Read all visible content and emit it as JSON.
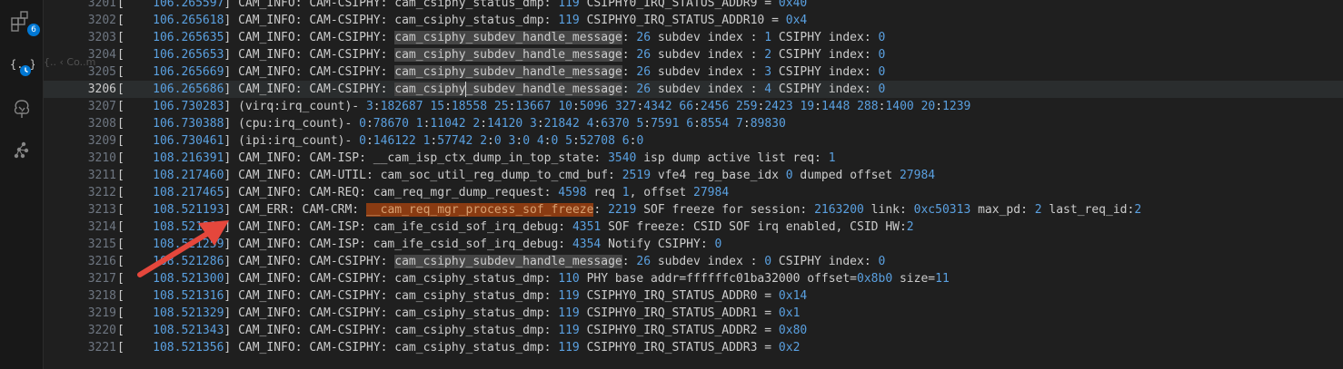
{
  "activity_bar": {
    "extensions_badge": "6"
  },
  "ghost_hint": "{.. ‹ Co..m",
  "colors": {
    "editor_bg": "#1f1f1f",
    "line_number": "#6e7681",
    "number": "#5aa0e0",
    "selection_highlight": "#454545",
    "error_highlight": "#8a3b12",
    "arrow": "#e5473c"
  },
  "editor": {
    "cursor_line": "3206",
    "lines": [
      {
        "n": "3201",
        "parts": [
          [
            "[    ",
            ""
          ],
          [
            "106.265597",
            "ts"
          ],
          [
            "] CAM_INFO: CAM-CSIPHY: cam_csiphy_status_dmp: ",
            ""
          ],
          [
            "119",
            "num"
          ],
          [
            " CSIPHY0_IRQ_STATUS_ADDR9 = ",
            ""
          ],
          [
            "0x40",
            "num"
          ]
        ]
      },
      {
        "n": "3202",
        "parts": [
          [
            "[    ",
            ""
          ],
          [
            "106.265618",
            "ts"
          ],
          [
            "] CAM_INFO: CAM-CSIPHY: cam_csiphy_status_dmp: ",
            ""
          ],
          [
            "119",
            "num"
          ],
          [
            " CSIPHY0_IRQ_STATUS_ADDR10 = ",
            ""
          ],
          [
            "0x4",
            "num"
          ]
        ]
      },
      {
        "n": "3203",
        "parts": [
          [
            "[    ",
            ""
          ],
          [
            "106.265635",
            "ts"
          ],
          [
            "] CAM_INFO: CAM-CSIPHY: ",
            ""
          ],
          [
            "cam_csiphy_subdev_handle_message",
            "hl"
          ],
          [
            ": ",
            ""
          ],
          [
            "26",
            "num"
          ],
          [
            " subdev index : ",
            ""
          ],
          [
            "1",
            "num"
          ],
          [
            " CSIPHY index: ",
            ""
          ],
          [
            "0",
            "num"
          ]
        ]
      },
      {
        "n": "3204",
        "parts": [
          [
            "[    ",
            ""
          ],
          [
            "106.265653",
            "ts"
          ],
          [
            "] CAM_INFO: CAM-CSIPHY: ",
            ""
          ],
          [
            "cam_csiphy_subdev_handle_message",
            "hl"
          ],
          [
            ": ",
            ""
          ],
          [
            "26",
            "num"
          ],
          [
            " subdev index : ",
            ""
          ],
          [
            "2",
            "num"
          ],
          [
            " CSIPHY index: ",
            ""
          ],
          [
            "0",
            "num"
          ]
        ]
      },
      {
        "n": "3205",
        "parts": [
          [
            "[    ",
            ""
          ],
          [
            "106.265669",
            "ts"
          ],
          [
            "] CAM_INFO: CAM-CSIPHY: ",
            ""
          ],
          [
            "cam_csiphy_subdev_handle_message",
            "hl"
          ],
          [
            ": ",
            ""
          ],
          [
            "26",
            "num"
          ],
          [
            " subdev index : ",
            ""
          ],
          [
            "3",
            "num"
          ],
          [
            " CSIPHY index: ",
            ""
          ],
          [
            "0",
            "num"
          ]
        ]
      },
      {
        "n": "3206",
        "parts": [
          [
            "[    ",
            ""
          ],
          [
            "106.265686",
            "ts"
          ],
          [
            "] CAM_INFO: CAM-CSIPHY: ",
            ""
          ],
          [
            "cam_csiphy_subdev_handle_message",
            "hl"
          ],
          [
            ": ",
            ""
          ],
          [
            "26",
            "num"
          ],
          [
            " subdev index : ",
            ""
          ],
          [
            "4",
            "num"
          ],
          [
            " CSIPHY index: ",
            ""
          ],
          [
            "0",
            "num"
          ]
        ]
      },
      {
        "n": "3207",
        "parts": [
          [
            "[    ",
            ""
          ],
          [
            "106.730283",
            "ts"
          ],
          [
            "] (virq:irq_count)- ",
            ""
          ],
          [
            "3",
            "num"
          ],
          [
            ":",
            ""
          ],
          [
            "182687",
            "num"
          ],
          [
            " ",
            ""
          ],
          [
            "15",
            "num"
          ],
          [
            ":",
            ""
          ],
          [
            "18558",
            "num"
          ],
          [
            " ",
            ""
          ],
          [
            "25",
            "num"
          ],
          [
            ":",
            ""
          ],
          [
            "13667",
            "num"
          ],
          [
            " ",
            ""
          ],
          [
            "10",
            "num"
          ],
          [
            ":",
            ""
          ],
          [
            "5096",
            "num"
          ],
          [
            " ",
            ""
          ],
          [
            "327",
            "num"
          ],
          [
            ":",
            ""
          ],
          [
            "4342",
            "num"
          ],
          [
            " ",
            ""
          ],
          [
            "66",
            "num"
          ],
          [
            ":",
            ""
          ],
          [
            "2456",
            "num"
          ],
          [
            " ",
            ""
          ],
          [
            "259",
            "num"
          ],
          [
            ":",
            ""
          ],
          [
            "2423",
            "num"
          ],
          [
            " ",
            ""
          ],
          [
            "19",
            "num"
          ],
          [
            ":",
            ""
          ],
          [
            "1448",
            "num"
          ],
          [
            " ",
            ""
          ],
          [
            "288",
            "num"
          ],
          [
            ":",
            ""
          ],
          [
            "1400",
            "num"
          ],
          [
            " ",
            ""
          ],
          [
            "20",
            "num"
          ],
          [
            ":",
            ""
          ],
          [
            "1239",
            "num"
          ]
        ]
      },
      {
        "n": "3208",
        "parts": [
          [
            "[    ",
            ""
          ],
          [
            "106.730388",
            "ts"
          ],
          [
            "] (cpu:irq_count)- ",
            ""
          ],
          [
            "0",
            "num"
          ],
          [
            ":",
            ""
          ],
          [
            "78670",
            "num"
          ],
          [
            " ",
            ""
          ],
          [
            "1",
            "num"
          ],
          [
            ":",
            ""
          ],
          [
            "11042",
            "num"
          ],
          [
            " ",
            ""
          ],
          [
            "2",
            "num"
          ],
          [
            ":",
            ""
          ],
          [
            "14120",
            "num"
          ],
          [
            " ",
            ""
          ],
          [
            "3",
            "num"
          ],
          [
            ":",
            ""
          ],
          [
            "21842",
            "num"
          ],
          [
            " ",
            ""
          ],
          [
            "4",
            "num"
          ],
          [
            ":",
            ""
          ],
          [
            "6370",
            "num"
          ],
          [
            " ",
            ""
          ],
          [
            "5",
            "num"
          ],
          [
            ":",
            ""
          ],
          [
            "7591",
            "num"
          ],
          [
            " ",
            ""
          ],
          [
            "6",
            "num"
          ],
          [
            ":",
            ""
          ],
          [
            "8554",
            "num"
          ],
          [
            " ",
            ""
          ],
          [
            "7",
            "num"
          ],
          [
            ":",
            ""
          ],
          [
            "89830",
            "num"
          ]
        ]
      },
      {
        "n": "3209",
        "parts": [
          [
            "[    ",
            ""
          ],
          [
            "106.730461",
            "ts"
          ],
          [
            "] (ipi:irq_count)- ",
            ""
          ],
          [
            "0",
            "num"
          ],
          [
            ":",
            ""
          ],
          [
            "146122",
            "num"
          ],
          [
            " ",
            ""
          ],
          [
            "1",
            "num"
          ],
          [
            ":",
            ""
          ],
          [
            "57742",
            "num"
          ],
          [
            " ",
            ""
          ],
          [
            "2",
            "num"
          ],
          [
            ":",
            ""
          ],
          [
            "0",
            "num"
          ],
          [
            " ",
            ""
          ],
          [
            "3",
            "num"
          ],
          [
            ":",
            ""
          ],
          [
            "0",
            "num"
          ],
          [
            " ",
            ""
          ],
          [
            "4",
            "num"
          ],
          [
            ":",
            ""
          ],
          [
            "0",
            "num"
          ],
          [
            " ",
            ""
          ],
          [
            "5",
            "num"
          ],
          [
            ":",
            ""
          ],
          [
            "52708",
            "num"
          ],
          [
            " ",
            ""
          ],
          [
            "6",
            "num"
          ],
          [
            ":",
            ""
          ],
          [
            "0",
            "num"
          ]
        ]
      },
      {
        "n": "3210",
        "parts": [
          [
            "[    ",
            ""
          ],
          [
            "108.216391",
            "ts"
          ],
          [
            "] CAM_INFO: CAM-ISP: __cam_isp_ctx_dump_in_top_state: ",
            ""
          ],
          [
            "3540",
            "num"
          ],
          [
            " isp dump active list req: ",
            ""
          ],
          [
            "1",
            "num"
          ]
        ]
      },
      {
        "n": "3211",
        "parts": [
          [
            "[    ",
            ""
          ],
          [
            "108.217460",
            "ts"
          ],
          [
            "] CAM_INFO: CAM-UTIL: cam_soc_util_reg_dump_to_cmd_buf: ",
            ""
          ],
          [
            "2519",
            "num"
          ],
          [
            " vfe4 reg_base_idx ",
            ""
          ],
          [
            "0",
            "num"
          ],
          [
            " dumped offset ",
            ""
          ],
          [
            "27984",
            "num"
          ]
        ]
      },
      {
        "n": "3212",
        "parts": [
          [
            "[    ",
            ""
          ],
          [
            "108.217465",
            "ts"
          ],
          [
            "] CAM_INFO: CAM-REQ: cam_req_mgr_dump_request: ",
            ""
          ],
          [
            "4598",
            "num"
          ],
          [
            " req ",
            ""
          ],
          [
            "1",
            "num"
          ],
          [
            ", offset ",
            ""
          ],
          [
            "27984",
            "num"
          ]
        ]
      },
      {
        "n": "3213",
        "parts": [
          [
            "[    ",
            ""
          ],
          [
            "108.521193",
            "ts"
          ],
          [
            "] CAM_ERR: CAM-CRM: ",
            ""
          ],
          [
            "__cam_req_mgr_process_sof_freeze",
            "err"
          ],
          [
            ": ",
            ""
          ],
          [
            "2219",
            "num"
          ],
          [
            " SOF freeze for session: ",
            ""
          ],
          [
            "2163200",
            "num"
          ],
          [
            " link: ",
            ""
          ],
          [
            "0xc50313",
            "num"
          ],
          [
            " max_pd: ",
            ""
          ],
          [
            "2",
            "num"
          ],
          [
            " last_req_id:",
            ""
          ],
          [
            "2",
            "num"
          ]
        ]
      },
      {
        "n": "3214",
        "parts": [
          [
            "[    ",
            ""
          ],
          [
            "108.521217",
            "ts"
          ],
          [
            "] CAM_INFO: CAM-ISP: cam_ife_csid_sof_irq_debug: ",
            ""
          ],
          [
            "4351",
            "num"
          ],
          [
            " SOF freeze: CSID SOF irq enabled, CSID HW:",
            ""
          ],
          [
            "2",
            "num"
          ]
        ]
      },
      {
        "n": "3215",
        "parts": [
          [
            "[    ",
            ""
          ],
          [
            "108.521259",
            "ts"
          ],
          [
            "] CAM_INFO: CAM-ISP: cam_ife_csid_sof_irq_debug: ",
            ""
          ],
          [
            "4354",
            "num"
          ],
          [
            " Notify CSIPHY: ",
            ""
          ],
          [
            "0",
            "num"
          ]
        ]
      },
      {
        "n": "3216",
        "parts": [
          [
            "[    ",
            ""
          ],
          [
            "108.521286",
            "ts"
          ],
          [
            "] CAM_INFO: CAM-CSIPHY: ",
            ""
          ],
          [
            "cam_csiphy_subdev_handle_message",
            "hl"
          ],
          [
            ": ",
            ""
          ],
          [
            "26",
            "num"
          ],
          [
            " subdev index : ",
            ""
          ],
          [
            "0",
            "num"
          ],
          [
            " CSIPHY index: ",
            ""
          ],
          [
            "0",
            "num"
          ]
        ]
      },
      {
        "n": "3217",
        "parts": [
          [
            "[    ",
            ""
          ],
          [
            "108.521300",
            "ts"
          ],
          [
            "] CAM_INFO: CAM-CSIPHY: cam_csiphy_status_dmp: ",
            ""
          ],
          [
            "110",
            "num"
          ],
          [
            " PHY base addr=ffffffc01ba32000 offset=",
            ""
          ],
          [
            "0x8b0",
            "num"
          ],
          [
            " size=",
            ""
          ],
          [
            "11",
            "num"
          ]
        ]
      },
      {
        "n": "3218",
        "parts": [
          [
            "[    ",
            ""
          ],
          [
            "108.521316",
            "ts"
          ],
          [
            "] CAM_INFO: CAM-CSIPHY: cam_csiphy_status_dmp: ",
            ""
          ],
          [
            "119",
            "num"
          ],
          [
            " CSIPHY0_IRQ_STATUS_ADDR0 = ",
            ""
          ],
          [
            "0x14",
            "num"
          ]
        ]
      },
      {
        "n": "3219",
        "parts": [
          [
            "[    ",
            ""
          ],
          [
            "108.521329",
            "ts"
          ],
          [
            "] CAM_INFO: CAM-CSIPHY: cam_csiphy_status_dmp: ",
            ""
          ],
          [
            "119",
            "num"
          ],
          [
            " CSIPHY0_IRQ_STATUS_ADDR1 = ",
            ""
          ],
          [
            "0x1",
            "num"
          ]
        ]
      },
      {
        "n": "3220",
        "parts": [
          [
            "[    ",
            ""
          ],
          [
            "108.521343",
            "ts"
          ],
          [
            "] CAM_INFO: CAM-CSIPHY: cam_csiphy_status_dmp: ",
            ""
          ],
          [
            "119",
            "num"
          ],
          [
            " CSIPHY0_IRQ_STATUS_ADDR2 = ",
            ""
          ],
          [
            "0x80",
            "num"
          ]
        ]
      },
      {
        "n": "3221",
        "parts": [
          [
            "[    ",
            ""
          ],
          [
            "108.521356",
            "ts"
          ],
          [
            "] CAM_INFO: CAM-CSIPHY: cam_csiphy_status_dmp: ",
            ""
          ],
          [
            "119",
            "num"
          ],
          [
            " CSIPHY0_IRQ_STATUS_ADDR3 = ",
            ""
          ],
          [
            "0x2",
            "num"
          ]
        ]
      }
    ]
  }
}
